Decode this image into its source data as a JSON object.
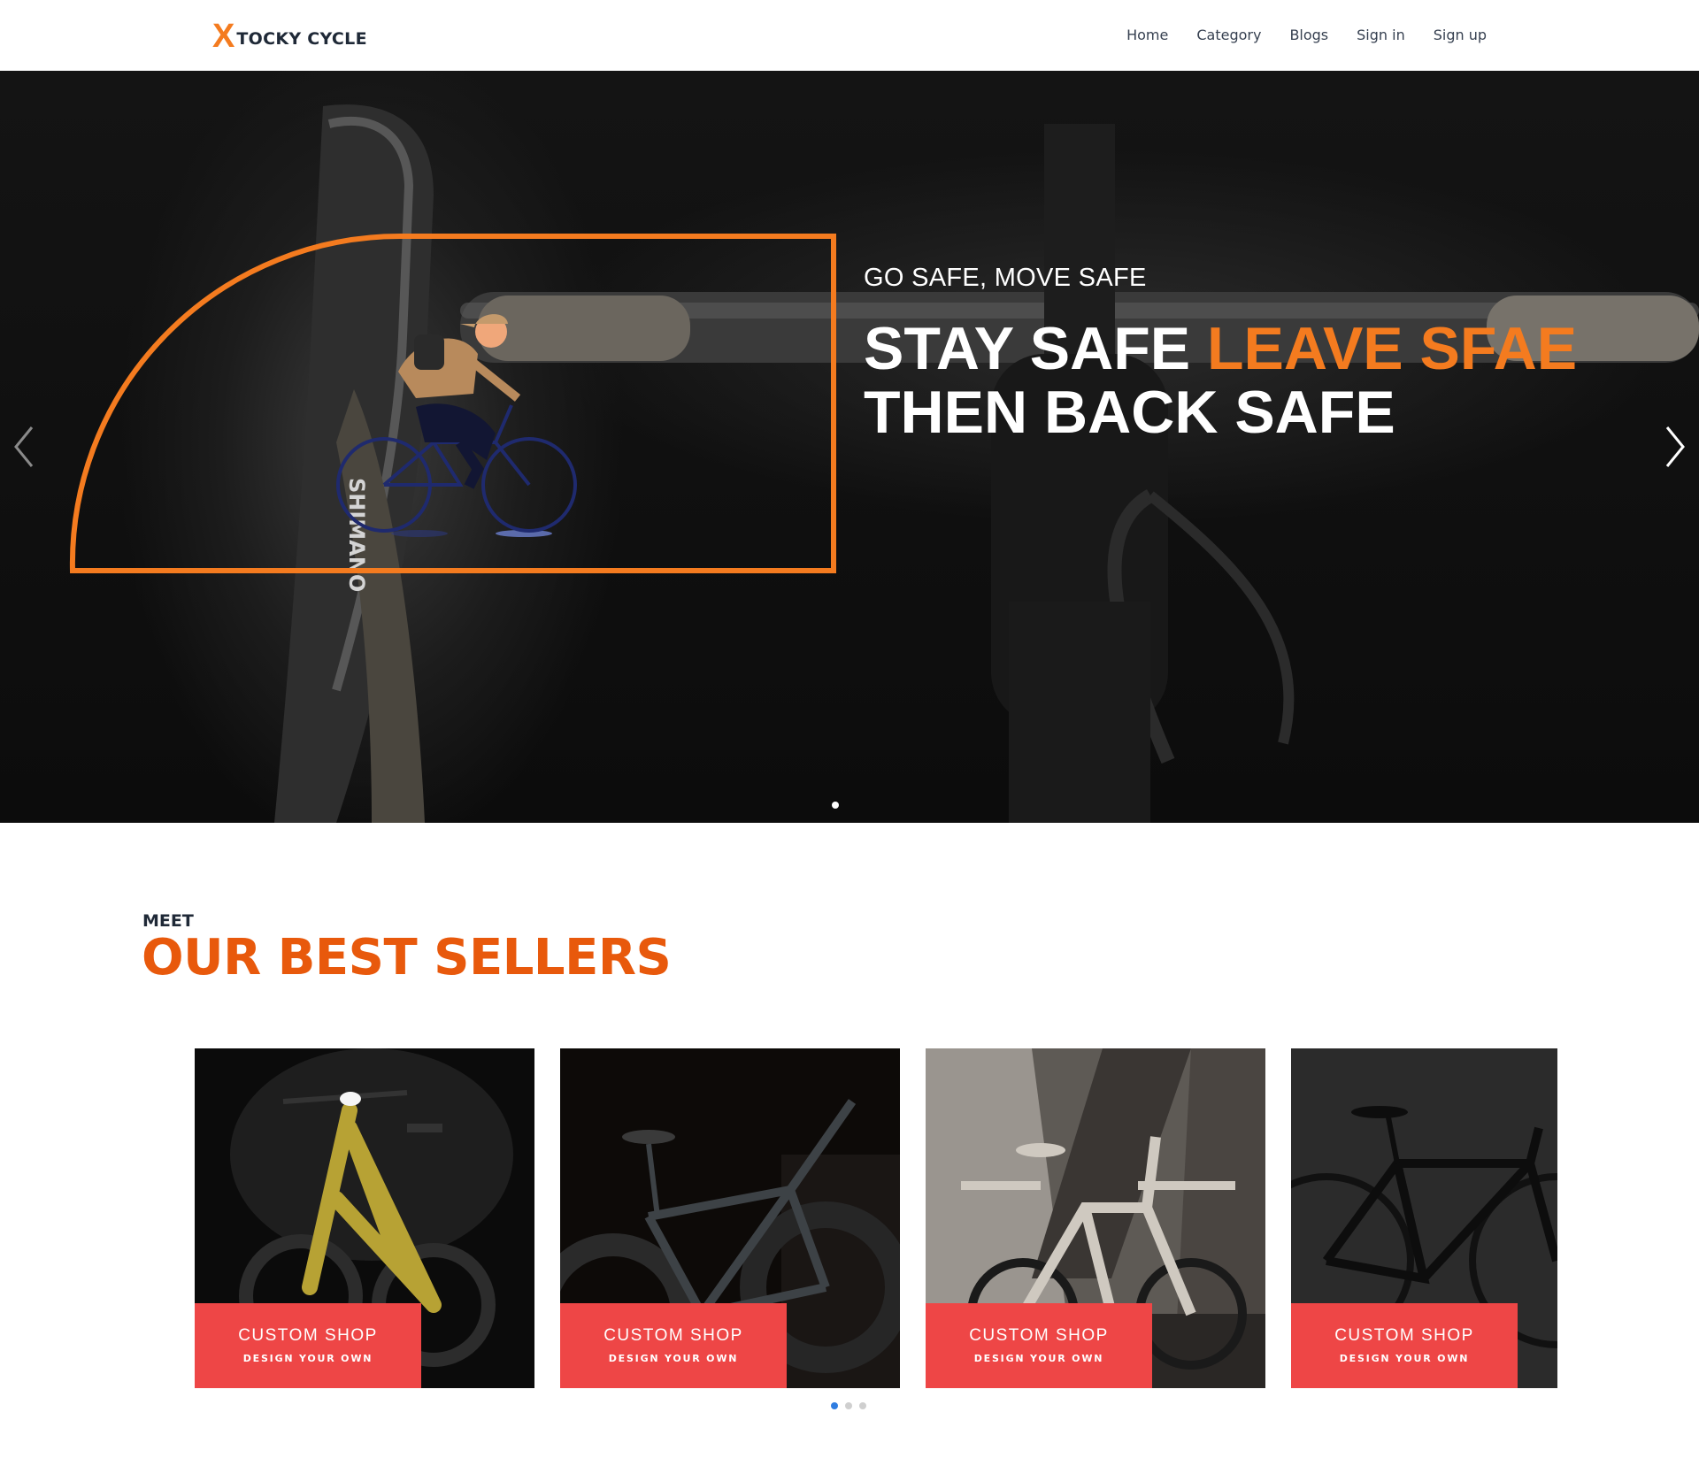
{
  "nav": {
    "brand_x": "X",
    "brand_rest": "TOCKY CYCLE",
    "links": [
      "Home",
      "Category",
      "Blogs",
      "Sign in",
      "Sign up"
    ]
  },
  "hero": {
    "subtitle": "GO SAFE, MOVE SAFE",
    "title_line1_a": "STAY SAFE ",
    "title_line1_b": "LEAVE SFAE",
    "title_line2": "THEN BACK SAFE",
    "brand_mark_on_bike": "SHIMANO",
    "prev_icon": "chevron-left-icon",
    "next_icon": "chevron-right-icon",
    "slide_count": 1,
    "active_slide": 1
  },
  "sellers": {
    "eyebrow": "MEET",
    "title": "OUR BEST SELLERS",
    "cards": [
      {
        "line1": "CUSTOM SHOP",
        "line2": "DESIGN YOUR OWN"
      },
      {
        "line1": "CUSTOM SHOP",
        "line2": "DESIGN YOUR OWN"
      },
      {
        "line1": "CUSTOM SHOP",
        "line2": "DESIGN YOUR OWN"
      },
      {
        "line1": "CUSTOM SHOP",
        "line2": "DESIGN YOUR OWN"
      }
    ],
    "page_count": 3,
    "active_page": 1
  },
  "colors": {
    "accent": "#f47b1f",
    "title_orange": "#e8590c",
    "card_label": "#ee4646",
    "dot_active": "#2f7de1"
  }
}
